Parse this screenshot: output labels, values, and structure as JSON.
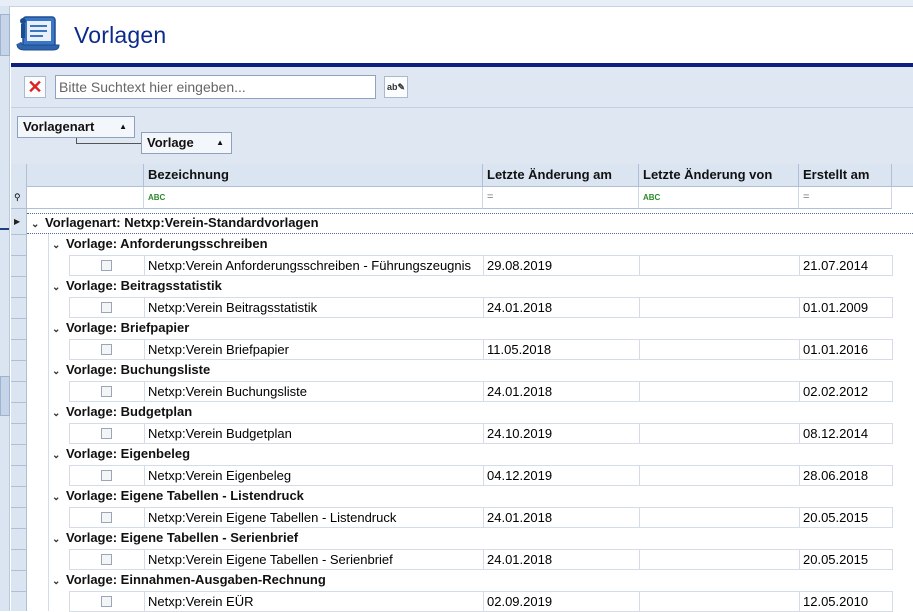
{
  "header": {
    "title": "Vorlagen",
    "icon": "template-scroll-icon"
  },
  "search": {
    "placeholder": "Bitte Suchtext hier eingeben...",
    "value": ""
  },
  "grouping": {
    "level1": "Vorlagenart",
    "level2": "Vorlage"
  },
  "columns": [
    "Bezeichnung",
    "Letzte Änderung am",
    "Letzte Änderung von",
    "Erstellt am"
  ],
  "top_group": "Vorlagenart: Netxp:Verein-Standardvorlagen",
  "groups": [
    {
      "label": "Vorlage: Anforderungsschreiben",
      "name": "Netxp:Verein Anforderungsschreiben - Führungszeugnis",
      "changed": "29.08.2019",
      "changed_by": "",
      "created": "21.07.2014"
    },
    {
      "label": "Vorlage: Beitragsstatistik",
      "name": "Netxp:Verein Beitragsstatistik",
      "changed": "24.01.2018",
      "changed_by": "",
      "created": "01.01.2009"
    },
    {
      "label": "Vorlage: Briefpapier",
      "name": "Netxp:Verein Briefpapier",
      "changed": "11.05.2018",
      "changed_by": "",
      "created": "01.01.2016"
    },
    {
      "label": "Vorlage: Buchungsliste",
      "name": "Netxp:Verein Buchungsliste",
      "changed": "24.01.2018",
      "changed_by": "",
      "created": "02.02.2012"
    },
    {
      "label": "Vorlage: Budgetplan",
      "name": "Netxp:Verein Budgetplan",
      "changed": "24.10.2019",
      "changed_by": "",
      "created": "08.12.2014"
    },
    {
      "label": "Vorlage: Eigenbeleg",
      "name": "Netxp:Verein Eigenbeleg",
      "changed": "04.12.2019",
      "changed_by": "",
      "created": "28.06.2018"
    },
    {
      "label": "Vorlage: Eigene Tabellen - Listendruck",
      "name": "Netxp:Verein Eigene Tabellen - Listendruck",
      "changed": "24.01.2018",
      "changed_by": "",
      "created": "20.05.2015"
    },
    {
      "label": "Vorlage: Eigene Tabellen - Serienbrief",
      "name": "Netxp:Verein Eigene Tabellen - Serienbrief",
      "changed": "24.01.2018",
      "changed_by": "",
      "created": "20.05.2015"
    },
    {
      "label": "Vorlage: Einnahmen-Ausgaben-Rechnung",
      "name": "Netxp:Verein EÜR",
      "changed": "02.09.2019",
      "changed_by": "",
      "created": "12.05.2010"
    }
  ],
  "colors": {
    "title": "#0c2a8c",
    "header_rule": "#0b1f7e",
    "panel_bg": "#dfe7f2",
    "grid_header_bg": "#dbe5f1"
  }
}
